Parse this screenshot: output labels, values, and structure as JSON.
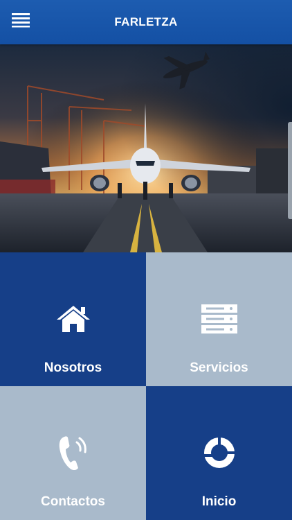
{
  "app": {
    "title": "FARLETZA"
  },
  "icons": {
    "menu": "hamburger-menu-icon",
    "nosotros": "home-icon",
    "servicios": "server-list-icon",
    "contactos": "phone-ringing-icon",
    "inicio": "ring-logo-icon"
  },
  "tiles": [
    {
      "label": "Nosotros"
    },
    {
      "label": "Servicios"
    },
    {
      "label": "Contactos"
    },
    {
      "label": "Inicio"
    }
  ],
  "colors": {
    "appbar": "#1450a4",
    "tile_dark": "#163f88",
    "tile_light": "#a9bacb",
    "text": "#ffffff"
  }
}
